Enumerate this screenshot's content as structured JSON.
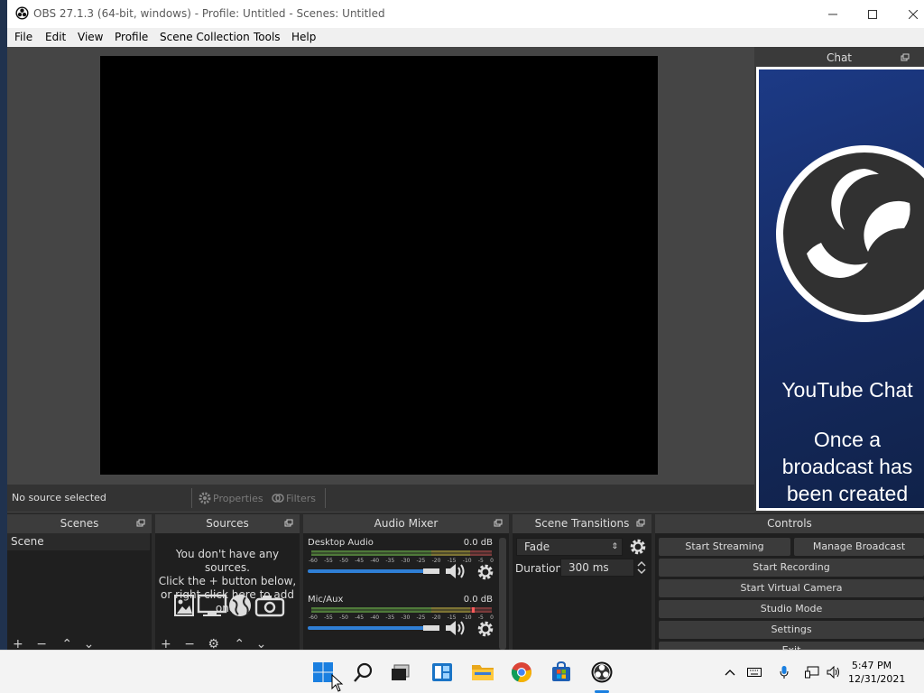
{
  "window": {
    "title": "OBS 27.1.3 (64-bit, windows) - Profile: Untitled - Scenes: Untitled"
  },
  "menu": [
    "File",
    "Edit",
    "View",
    "Profile",
    "Scene Collection",
    "Tools",
    "Help"
  ],
  "source_bar": {
    "status": "No source selected",
    "properties_label": "Properties",
    "filters_label": "Filters"
  },
  "chat": {
    "title": "Chat",
    "heading": "YouTube Chat",
    "message": [
      "Once a",
      "broadcast has",
      "been created"
    ]
  },
  "scenes": {
    "title": "Scenes",
    "items": [
      "Scene"
    ]
  },
  "sources": {
    "title": "Sources",
    "empty_lines": [
      "You don't have any sources.",
      "Click the + button below,",
      "or right click here to add one."
    ]
  },
  "audio_mixer": {
    "title": "Audio Mixer",
    "scale": [
      "-60",
      "-55",
      "-50",
      "-45",
      "-40",
      "-35",
      "-30",
      "-25",
      "-20",
      "-15",
      "-10",
      "-5",
      "0"
    ],
    "tracks": [
      {
        "name": "Desktop Audio",
        "db": "0.0 dB",
        "volume": 1.0
      },
      {
        "name": "Mic/Aux",
        "db": "0.0 dB",
        "volume": 1.0
      }
    ]
  },
  "scene_transitions": {
    "title": "Scene Transitions",
    "transition": "Fade",
    "duration_label": "Duration",
    "duration_value": "300 ms"
  },
  "controls": {
    "title": "Controls",
    "start_streaming": "Start Streaming",
    "manage_broadcast": "Manage Broadcast",
    "start_recording": "Start Recording",
    "start_virtual_camera": "Start Virtual Camera",
    "studio_mode": "Studio Mode",
    "settings": "Settings",
    "exit": "Exit"
  },
  "taskbar": {
    "time": "5:47 PM",
    "date": "12/31/2021"
  },
  "colors": {
    "obs_dark": "#2b2b2b",
    "preview": "#000000",
    "accent": "#2f7fd6",
    "chat_bg": "#1c3a86"
  }
}
